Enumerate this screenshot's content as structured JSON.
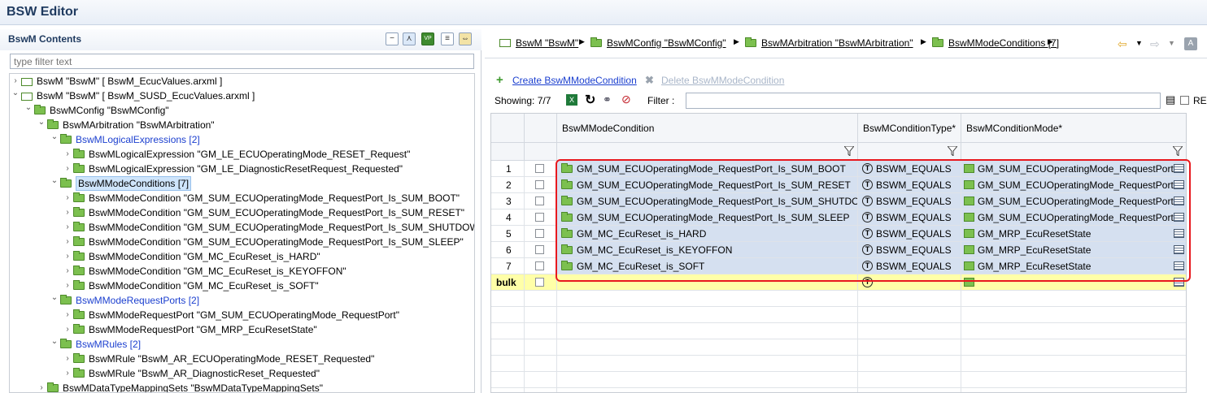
{
  "window": {
    "title": "BSW Editor"
  },
  "left_panel": {
    "title": "BswM Contents",
    "filter_placeholder": "type filter text",
    "tree": [
      {
        "label": "BswM \"BswM\" [ BswM_EcucValues.arxml ]",
        "level": 0,
        "toggle": "›",
        "icon": "resource-icon",
        "style": "normal"
      },
      {
        "label": "BswM \"BswM\" [ BswM_SUSD_EcucValues.arxml ]",
        "level": 0,
        "toggle": "⌄",
        "icon": "resource-icon",
        "style": "normal"
      },
      {
        "label": "BswMConfig \"BswMConfig\"",
        "level": 1,
        "toggle": "⌄",
        "icon": "folder-icon",
        "style": "normal"
      },
      {
        "label": "BswMArbitration \"BswMArbitration\"",
        "level": 2,
        "toggle": "⌄",
        "icon": "folder-icon",
        "style": "normal"
      },
      {
        "label": "BswMLogicalExpressions [2]",
        "level": 3,
        "toggle": "⌄",
        "icon": "folder-icon",
        "style": "blue"
      },
      {
        "label": "BswMLogicalExpression \"GM_LE_ECUOperatingMode_RESET_Request\"",
        "level": 4,
        "toggle": "›",
        "icon": "folder-icon",
        "style": "normal"
      },
      {
        "label": "BswMLogicalExpression \"GM_LE_DiagnosticResetRequest_Requested\"",
        "level": 4,
        "toggle": "›",
        "icon": "folder-icon",
        "style": "normal"
      },
      {
        "label": "BswMModeConditions [7]",
        "level": 3,
        "toggle": "⌄",
        "icon": "folder-icon",
        "style": "selected"
      },
      {
        "label": "BswMModeCondition \"GM_SUM_ECUOperatingMode_RequestPort_Is_SUM_BOOT\"",
        "level": 4,
        "toggle": "›",
        "icon": "folder-icon",
        "style": "normal"
      },
      {
        "label": "BswMModeCondition \"GM_SUM_ECUOperatingMode_RequestPort_Is_SUM_RESET\"",
        "level": 4,
        "toggle": "›",
        "icon": "folder-icon",
        "style": "normal"
      },
      {
        "label": "BswMModeCondition \"GM_SUM_ECUOperatingMode_RequestPort_Is_SUM_SHUTDOWN\"",
        "level": 4,
        "toggle": "›",
        "icon": "folder-icon",
        "style": "normal"
      },
      {
        "label": "BswMModeCondition \"GM_SUM_ECUOperatingMode_RequestPort_Is_SUM_SLEEP\"",
        "level": 4,
        "toggle": "›",
        "icon": "folder-icon",
        "style": "normal"
      },
      {
        "label": "BswMModeCondition \"GM_MC_EcuReset_is_HARD\"",
        "level": 4,
        "toggle": "›",
        "icon": "folder-icon",
        "style": "normal"
      },
      {
        "label": "BswMModeCondition \"GM_MC_EcuReset_is_KEYOFFON\"",
        "level": 4,
        "toggle": "›",
        "icon": "folder-icon",
        "style": "normal"
      },
      {
        "label": "BswMModeCondition \"GM_MC_EcuReset_is_SOFT\"",
        "level": 4,
        "toggle": "›",
        "icon": "folder-icon",
        "style": "normal"
      },
      {
        "label": "BswMModeRequestPorts [2]",
        "level": 3,
        "toggle": "⌄",
        "icon": "folder-icon",
        "style": "blue"
      },
      {
        "label": "BswMModeRequestPort \"GM_SUM_ECUOperatingMode_RequestPort\"",
        "level": 4,
        "toggle": "›",
        "icon": "folder-icon",
        "style": "normal"
      },
      {
        "label": "BswMModeRequestPort \"GM_MRP_EcuResetState\"",
        "level": 4,
        "toggle": "›",
        "icon": "folder-icon",
        "style": "normal"
      },
      {
        "label": "BswMRules [2]",
        "level": 3,
        "toggle": "⌄",
        "icon": "folder-icon",
        "style": "blue"
      },
      {
        "label": "BswMRule \"BswM_AR_ECUOperatingMode_RESET_Requested\"",
        "level": 4,
        "toggle": "›",
        "icon": "folder-icon",
        "style": "normal"
      },
      {
        "label": "BswMRule \"BswM_AR_DiagnosticReset_Requested\"",
        "level": 4,
        "toggle": "›",
        "icon": "folder-icon",
        "style": "normal"
      },
      {
        "label": "BswMDataTypeMappingSets \"BswMDataTypeMappingSets\"",
        "level": 2,
        "toggle": "›",
        "icon": "folder-icon",
        "style": "normal"
      }
    ]
  },
  "breadcrumb": [
    {
      "label": "BswM \"BswM\"",
      "icon": "resource-icon"
    },
    {
      "label": "BswMConfig \"BswMConfig\"",
      "icon": "folder-icon"
    },
    {
      "label": "BswMArbitration \"BswMArbitration\"",
      "icon": "folder-icon"
    },
    {
      "label": "BswMModeConditions [7]",
      "icon": "folder-icon"
    }
  ],
  "actions": {
    "create": "Create BswMModeCondition",
    "delete": "Delete BswMModeCondition"
  },
  "toolbar": {
    "showing": "Showing: 7/7",
    "filter_label": "Filter :",
    "re_label": "RE"
  },
  "grid": {
    "columns": [
      "BswMModeCondition",
      "BswMConditionType*",
      "BswMConditionMode*"
    ],
    "rows": [
      {
        "num": "1",
        "condition": "GM_SUM_ECUOperatingMode_RequestPort_Is_SUM_BOOT",
        "type": "BSWM_EQUALS",
        "mode": "GM_SUM_ECUOperatingMode_RequestPort"
      },
      {
        "num": "2",
        "condition": "GM_SUM_ECUOperatingMode_RequestPort_Is_SUM_RESET",
        "type": "BSWM_EQUALS",
        "mode": "GM_SUM_ECUOperatingMode_RequestPort"
      },
      {
        "num": "3",
        "condition": "GM_SUM_ECUOperatingMode_RequestPort_Is_SUM_SHUTDOWN",
        "type": "BSWM_EQUALS",
        "mode": "GM_SUM_ECUOperatingMode_RequestPort"
      },
      {
        "num": "4",
        "condition": "GM_SUM_ECUOperatingMode_RequestPort_Is_SUM_SLEEP",
        "type": "BSWM_EQUALS",
        "mode": "GM_SUM_ECUOperatingMode_RequestPort"
      },
      {
        "num": "5",
        "condition": "GM_MC_EcuReset_is_HARD",
        "type": "BSWM_EQUALS",
        "mode": "GM_MRP_EcuResetState"
      },
      {
        "num": "6",
        "condition": "GM_MC_EcuReset_is_KEYOFFON",
        "type": "BSWM_EQUALS",
        "mode": "GM_MRP_EcuResetState"
      },
      {
        "num": "7",
        "condition": "GM_MC_EcuReset_is_SOFT",
        "type": "BSWM_EQUALS",
        "mode": "GM_MRP_EcuResetState"
      }
    ],
    "bulk_label": "bulk"
  },
  "colors": {
    "highlight": "#e8191f",
    "selection": "#d5e0f0",
    "bulk_row": "#ffffa8",
    "link": "#1b3fcf"
  }
}
